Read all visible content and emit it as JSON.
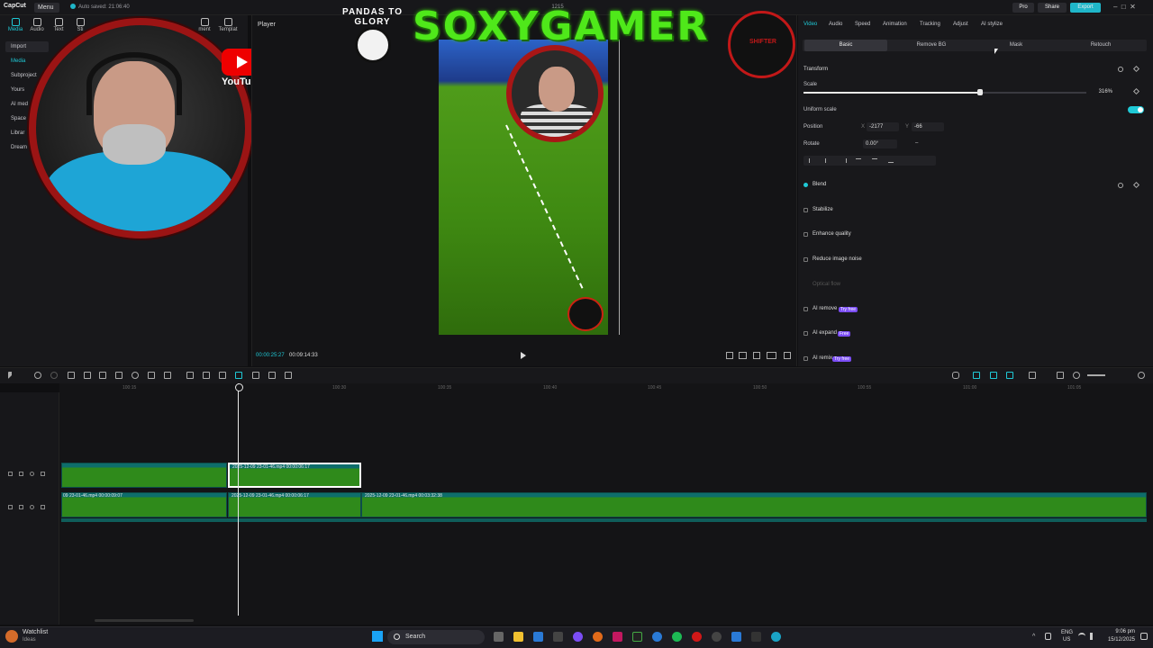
{
  "app": {
    "logo": "CapCut",
    "menu": "Menu",
    "autosave": "Auto saved: 21:06:40",
    "center_label": "1215",
    "pro_label": "Pro",
    "share_label": "Share",
    "export_label": "Export"
  },
  "left_tabs": [
    "Media",
    "Audio",
    "Text",
    "Sti",
    "ment",
    "Templat"
  ],
  "left_nav": [
    "Import",
    "Media",
    "Subproject",
    "Yours",
    "AI med",
    "Space",
    "Librar",
    "Dream"
  ],
  "overlay": {
    "youtube": "YouTube",
    "pandas": "PANDAS TO GLORY",
    "banner": "SOXYGAMER",
    "shield": "SHIFTER"
  },
  "player": {
    "title": "Player",
    "current_time": "00:00:25:27",
    "total_time": "00:09:14:33"
  },
  "right_tabs": [
    "Video",
    "Audio",
    "Speed",
    "Animation",
    "Tracking",
    "Adjust",
    "AI stylize"
  ],
  "sub_tabs": [
    "Basic",
    "Remove BG",
    "Mask",
    "Retouch"
  ],
  "properties": {
    "transform": "Transform",
    "scale_label": "Scale",
    "scale_value": "316%",
    "scale_fraction": 0.625,
    "uniform_scale": "Uniform scale",
    "position_label": "Position",
    "pos_x_label": "X",
    "pos_x": "-2177",
    "pos_y_label": "Y",
    "pos_y": "-66",
    "rotate_label": "Rotate",
    "rotate_value": "0.00°",
    "rotate_dash": "–",
    "sections": [
      {
        "label": "Blend",
        "badge": ""
      },
      {
        "label": "Stabilize",
        "badge": ""
      },
      {
        "label": "Enhance quality",
        "badge": ""
      },
      {
        "label": "Reduce image noise",
        "badge": ""
      },
      {
        "label": "Optical flow",
        "badge": ""
      },
      {
        "label": "AI remove",
        "badge": "Try free"
      },
      {
        "label": "AI expand",
        "badge": "Free"
      },
      {
        "label": "AI remix",
        "badge": "Try free"
      }
    ]
  },
  "timeline": {
    "ticks": [
      "100:15",
      "100:30",
      "100:35",
      "100:40",
      "100:45",
      "100:50",
      "100:55",
      "101:00",
      "101:05"
    ],
    "clips": [
      {
        "label": "2025-12-09 23-01-46.mp4   00:00:06:17"
      },
      {
        "label": "2025-12-09 23-01-46.mp4   00:00:06:17"
      },
      {
        "label": "09 23-01-46.mp4   00:00:09:07"
      },
      {
        "label": "2025-12-09 23-01-46.mp4   00:03:32:38"
      }
    ]
  },
  "taskbar": {
    "watchlist": "Watchlist",
    "ideas": "Ideas",
    "search": "Search",
    "lang": "ENG",
    "region": "US",
    "time": "9:06 pm",
    "date": "15/12/2025"
  }
}
